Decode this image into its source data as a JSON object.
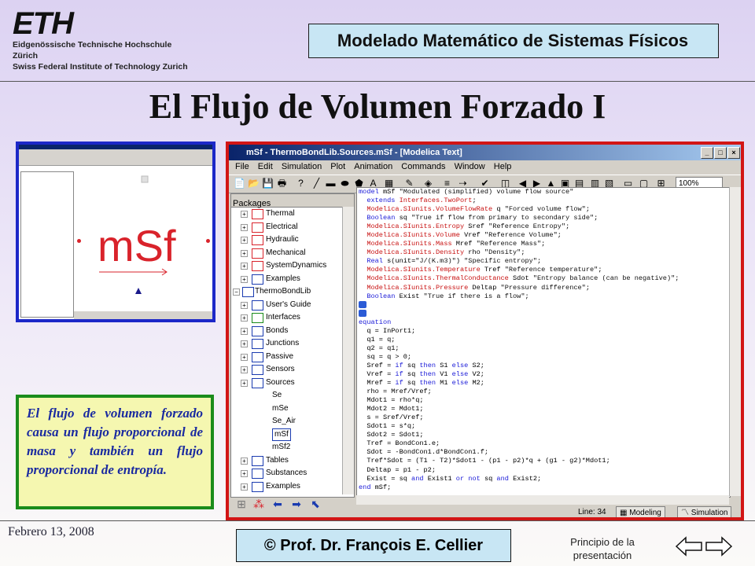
{
  "header": {
    "logo_text": "ETH",
    "logo_line1": "Eidgenössische Technische Hochschule Zürich",
    "logo_line2": "Swiss Federal Institute of Technology Zurich",
    "course_title": "Modelado Matemático de Sistemas Físicos"
  },
  "slide_title": "El Flujo de Volumen Forzado I",
  "thumbnail": {
    "symbol_text": "mSf"
  },
  "note_text": "El flujo de volumen forzado causa un flujo proporcional de masa y también un flujo proporcional de entropía.",
  "window": {
    "title": "mSf - ThermoBondLib.Sources.mSf - [Modelica Text]",
    "menu": [
      "File",
      "Edit",
      "Simulation",
      "Plot",
      "Animation",
      "Commands",
      "Window",
      "Help"
    ],
    "zoom": "100%",
    "packages_label": "Packages",
    "tree": [
      {
        "label": "Thermal",
        "type": "pkg"
      },
      {
        "label": "Electrical",
        "type": "pkg"
      },
      {
        "label": "Hydraulic",
        "type": "pkg"
      },
      {
        "label": "Mechanical",
        "type": "pkg"
      },
      {
        "label": "SystemDynamics",
        "type": "pkg"
      },
      {
        "label": "Examples",
        "type": "pkg"
      },
      {
        "label": "ThermoBondLib",
        "type": "root"
      },
      {
        "label": "User's Guide",
        "type": "pkg"
      },
      {
        "label": "Interfaces",
        "type": "pkg"
      },
      {
        "label": "Bonds",
        "type": "pkg"
      },
      {
        "label": "Junctions",
        "type": "pkg"
      },
      {
        "label": "Passive",
        "type": "pkg"
      },
      {
        "label": "Sensors",
        "type": "pkg"
      },
      {
        "label": "Sources",
        "type": "pkg"
      },
      {
        "label": "Se",
        "type": "item"
      },
      {
        "label": "mSe",
        "type": "item"
      },
      {
        "label": "Se_Air",
        "type": "item"
      },
      {
        "label": "mSf",
        "type": "item",
        "selected": true
      },
      {
        "label": "mSf2",
        "type": "item"
      },
      {
        "label": "Tables",
        "type": "pkg"
      },
      {
        "label": "Substances",
        "type": "pkg"
      },
      {
        "label": "Examples",
        "type": "pkg"
      }
    ],
    "code_lines": [
      "model mSf \"Modulated (simplified) volume flow source\"",
      "  extends Interfaces.TwoPort;",
      "  Modelica.SIunits.VolumeFlowRate q \"Forced volume flow\";",
      "  Boolean sq \"True if flow from primary to secondary side\";",
      "  Modelica.SIunits.Entropy Sref \"Reference Entropy\";",
      "  Modelica.SIunits.Volume Vref \"Reference Volume\";",
      "  Modelica.SIunits.Mass Mref \"Reference Mass\";",
      "  Modelica.SIunits.Density rho \"Density\";",
      "  Real s(unit=\"J/(K.m3)\") \"Specific entropy\";",
      "  Modelica.SIunits.Temperature Tref \"Reference temperature\";",
      "  Modelica.SIunits.ThermalConductance Sdot \"Entropy balance (can be negative)\";",
      "  Modelica.SIunits.Pressure Deltap \"Pressure difference\";",
      "  Boolean Exist \"True if there is a flow\";",
      "",
      "",
      "equation",
      "  q = InPort1;",
      "  q1 = q;",
      "  q2 = q1;",
      "  sq = q > 0;",
      "  Sref = if sq then S1 else S2;",
      "  Vref = if sq then V1 else V2;",
      "  Mref = if sq then M1 else M2;",
      "  rho = Mref/Vref;",
      "  Mdot1 = rho*q;",
      "  Mdot2 = Mdot1;",
      "  s = Sref/Vref;",
      "  Sdot1 = s*q;",
      "  Sdot2 = Sdot1;",
      "  Tref = BondCon1.e;",
      "  Sdot = -BondCon1.d*BondCon1.f;",
      "  Tref*Sdot = (T1 - T2)*Sdot1 - (p1 - p2)*q + (g1 - g2)*Mdot1;",
      "  Deltap = p1 - p2;",
      "  Exist = sq and Exist1 or not sq and Exist2;",
      "end mSf;"
    ],
    "status_line_label": "Line:",
    "status_line_value": "34",
    "modeling_label": "Modeling",
    "simulation_label": "Simulation"
  },
  "footer": {
    "date": "Febrero 13, 2008",
    "author": "© Prof. Dr. François E. Cellier",
    "home_link": "Principio de la presentación"
  }
}
